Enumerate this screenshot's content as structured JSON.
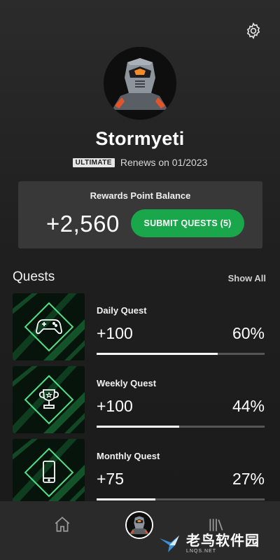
{
  "profile": {
    "gamertag": "Stormyeti",
    "badge": "ULTIMATE",
    "renews": "Renews on 01/2023"
  },
  "rewards": {
    "title": "Rewards Point Balance",
    "points": "+2,560",
    "submit_label": "SUBMIT QUESTS (5)",
    "accent": "#1aa64b"
  },
  "quests": {
    "heading": "Quests",
    "show_all": "Show All",
    "items": [
      {
        "name": "Daily Quest",
        "points": "+100",
        "percent": "60%",
        "progress": 0.72,
        "icon": "gamepad-icon"
      },
      {
        "name": "Weekly Quest",
        "points": "+100",
        "percent": "44%",
        "progress": 0.49,
        "icon": "trophy-icon"
      },
      {
        "name": "Monthly Quest",
        "points": "+75",
        "percent": "27%",
        "progress": 0.35,
        "icon": "phone-icon"
      }
    ]
  },
  "nav": {
    "items": [
      "home-icon",
      "profile-avatar",
      "library-icon"
    ]
  },
  "watermark": {
    "text": "老鸟软件园",
    "sub": "LNQS.NET"
  }
}
